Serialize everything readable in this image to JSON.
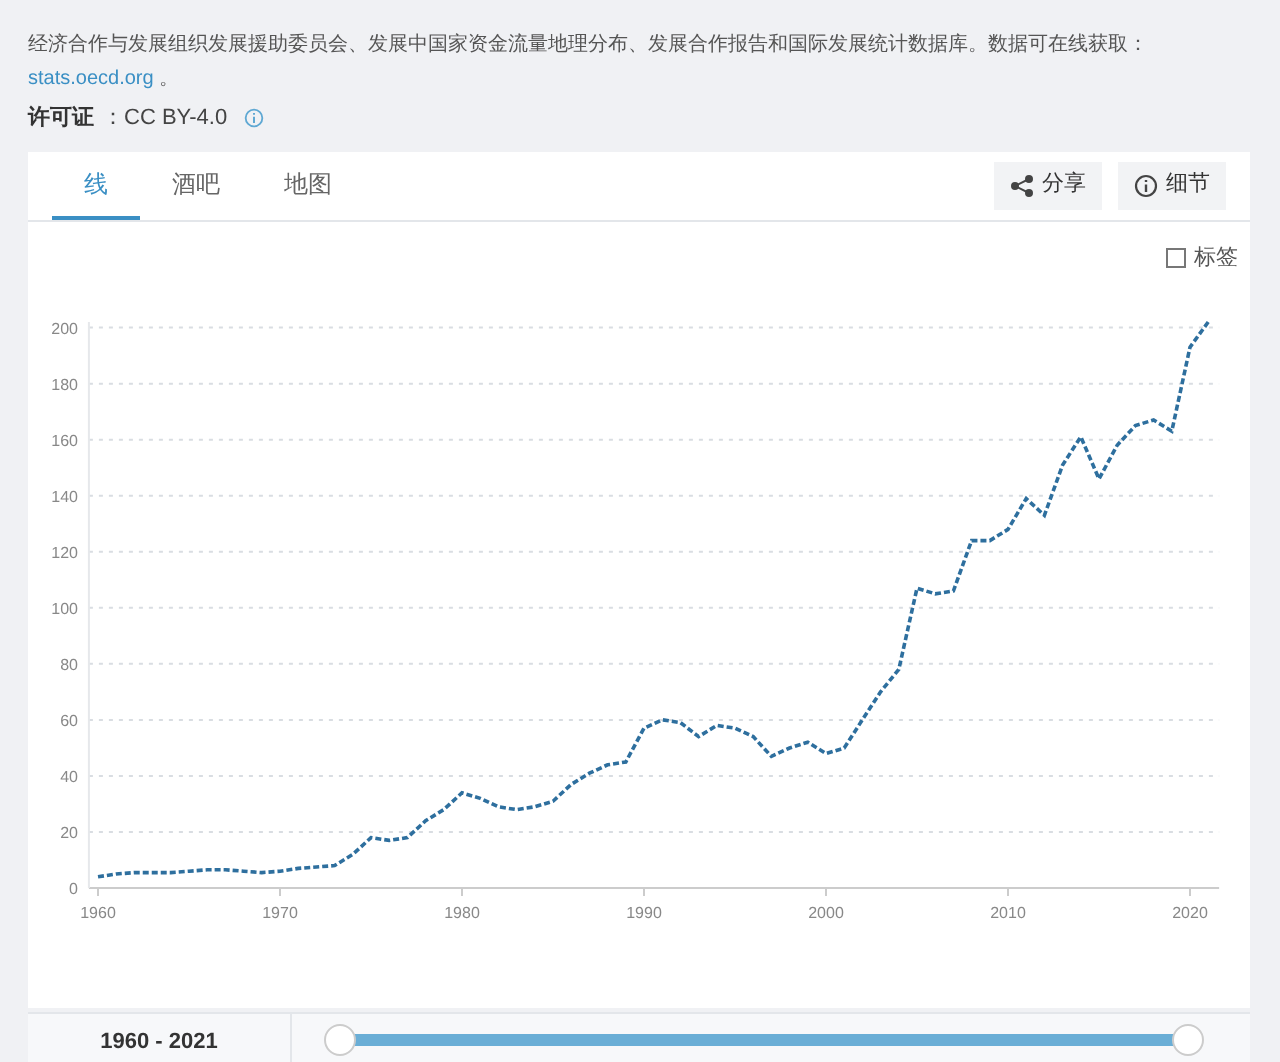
{
  "source": {
    "text": "经济合作与发展组织发展援助委员会、发展中国家资金流量地理分布、发展合作报告和国际发展统计数据库。数据可在线获取：",
    "link": "stats.oecd.org",
    "end": " 。"
  },
  "license": {
    "label": "许可证",
    "value": "：CC BY-4.0"
  },
  "tabs": [
    {
      "label": "线",
      "selected": true
    },
    {
      "label": "酒吧",
      "selected": false
    },
    {
      "label": "地图",
      "selected": false
    }
  ],
  "actions": [
    {
      "kind": "share",
      "label": "分享"
    },
    {
      "kind": "info",
      "label": "细节"
    }
  ],
  "labels_toggle": {
    "label": "标签",
    "checked": false
  },
  "chart": {
    "chart_data": {
      "type": "line",
      "x": [
        1960,
        1961,
        1962,
        1963,
        1964,
        1965,
        1966,
        1967,
        1968,
        1969,
        1970,
        1971,
        1972,
        1973,
        1974,
        1975,
        1976,
        1977,
        1978,
        1979,
        1980,
        1981,
        1982,
        1983,
        1984,
        1985,
        1986,
        1987,
        1988,
        1989,
        1990,
        1991,
        1992,
        1993,
        1994,
        1995,
        1996,
        1997,
        1998,
        1999,
        2000,
        2001,
        2002,
        2003,
        2004,
        2005,
        2006,
        2007,
        2008,
        2009,
        2010,
        2011,
        2012,
        2013,
        2014,
        2015,
        2016,
        2017,
        2018,
        2019,
        2020,
        2021
      ],
      "xlim": [
        1959.5,
        2021.6
      ],
      "ylim": [
        0,
        202
      ],
      "grid": true,
      "series": [
        {
          "color": "#2e6f9e",
          "line_style": "dashed",
          "values": [
            4,
            5,
            5.5,
            5.5,
            5.5,
            6,
            6.5,
            6.5,
            6,
            5.5,
            6,
            7,
            7.5,
            8,
            12,
            18,
            17,
            18,
            24,
            28,
            34,
            32,
            29,
            28,
            29,
            31,
            37,
            41,
            44,
            45,
            57,
            60,
            59,
            54,
            58,
            57,
            54,
            47,
            50,
            52,
            48,
            50,
            60,
            70,
            78,
            107,
            105,
            106,
            124,
            124,
            128,
            139,
            133,
            151,
            161,
            146,
            158,
            165,
            167,
            163,
            193,
            202
          ]
        }
      ],
      "xticks": [
        1960,
        1970,
        1980,
        1990,
        2000,
        2010,
        2020
      ],
      "yticks": [
        0,
        20,
        40,
        60,
        80,
        100,
        120,
        140,
        160,
        180,
        200
      ]
    }
  },
  "range": {
    "label": "1960 - 2021",
    "level": 1
  }
}
